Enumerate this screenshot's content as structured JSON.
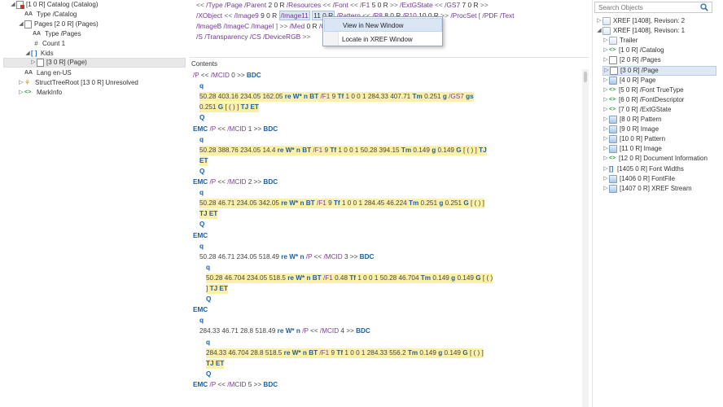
{
  "structure_tree": {
    "items": [
      {
        "label": "[1 0 R] Catalog  (Catalog)",
        "icon": "catalog-icon"
      },
      {
        "label": "Type /Catalog",
        "icon": "name-aa-icon"
      },
      {
        "label": "Pages [2 0 R]  (Pages)",
        "icon": "pages-icon"
      },
      {
        "label": "Type /Pages",
        "icon": "name-aa-icon"
      },
      {
        "label": "Count 1",
        "icon": "hash-icon"
      },
      {
        "label": "Kids",
        "icon": "array-icon"
      },
      {
        "label": "[3 0 R]  (Page)",
        "icon": "page-icon"
      },
      {
        "label": "Lang en-US",
        "icon": "name-aa-icon"
      },
      {
        "label": "StructTreeRoot [13 0 R] Unresolved",
        "icon": "structtree-icon"
      },
      {
        "label": "MarkInfo",
        "icon": "dict-icon"
      }
    ]
  },
  "dictionary": {
    "line1": [
      "<<",
      "/Type",
      "/Page",
      "/Parent",
      "2 0 R",
      "/Resources",
      "<<",
      "/Font",
      "<<",
      "/F1",
      "5 0 R",
      ">>",
      "/ExtGState",
      "<<",
      "/GS7",
      "7 0 R",
      ">>"
    ],
    "line2": [
      "/XObject",
      "<<",
      "/Image9",
      "9 0 R",
      "/Image11",
      "11 0 R",
      "/Pattern",
      "<<",
      "/P8",
      "8 0 R",
      "/P10",
      "10 0 R",
      ">>",
      "/ProcSet",
      "[",
      "/PDF",
      "/Text"
    ],
    "line3": [
      "/ImageB",
      "/ImageC",
      "/ImageI",
      "]",
      ">>",
      "/Med",
      "0 R",
      "/Group",
      "<<",
      "/Type",
      "/Group"
    ],
    "line4": [
      "/S",
      "/Transparency",
      "/CS",
      "/DeviceRGB",
      ">>"
    ]
  },
  "context_menu": {
    "items": [
      "View in New Window",
      "Locate in XREF Window"
    ]
  },
  "contents": {
    "label": "Contents",
    "lines": [
      "/P  <<  /MCID  0  >>  BDC",
      "q",
      "50.28  403.16  234.05  162.05  re  W*  n  BT  /F1  9  Tf  1  0  0  1  284.33  407.71  Tm  0.251  g  /GS7  gs",
      "0.251  G  [  ( )  ]  TJ  ET",
      "Q",
      "EMC  /P  <<  /MCID  1  >>  BDC",
      "q",
      "50.28  388.76  234.05  14.4  re  W*  n  BT  /F1  9  Tf  1  0  0  1  50.28  394.15  Tm  0.149  g  0.149  G  [  ( )  ]  TJ",
      "ET",
      "Q",
      "EMC  /P  <<  /MCID  2  >>  BDC",
      "q",
      "50.28  46.71  234.05  342.05  re  W*  n  BT  /F1  9  Tf  1  0  0  1  284.45  46.224  Tm  0.251  g  0.251  G  [  ( )  ]",
      "TJ  ET",
      "Q",
      "EMC",
      "q",
      "50.28  46.71  234.05  518.49  re  W*  n  /P  <<  /MCID  3  >>  BDC",
      "q",
      "50.28  46.704  234.05  518.5  re  W*  n  BT  /F1  0.48  Tf  1  0  0  1  50.28  46.704  Tm  0.149  g  0.149  G  [  ( )",
      "]  TJ  ET",
      "Q",
      "EMC",
      "q",
      "284.33  46.71  28.8  518.49  re  W*  n  /P  <<  /MCID  4  >>  BDC",
      "q",
      "284.33  46.704  28.8  518.5  re  W*  n  BT  /F1  9  Tf  1  0  0  1  284.33  556.2  Tm  0.149  g  0.149  G  [  ( )  ]",
      "TJ  ET",
      "Q",
      "EMC  /P  <<  /MCID  5  >>  BDC"
    ]
  },
  "objects_pane": {
    "search_placeholder": "Search Objects",
    "items": [
      {
        "label": "XREF [1408], Revison: 2",
        "kind": "xref"
      },
      {
        "label": "XREF [1408], Revison: 1",
        "kind": "xref"
      },
      {
        "label": "Trailer",
        "kind": "trailer"
      },
      {
        "label": "[1 0 R] /Catalog",
        "kind": "dict"
      },
      {
        "label": "[2 0 R] /Pages",
        "kind": "pages"
      },
      {
        "label": "[3 0 R] /Page",
        "kind": "page"
      },
      {
        "label": "[4 0 R] Page",
        "kind": "stream"
      },
      {
        "label": "[5 0 R] /Font TrueType",
        "kind": "dict"
      },
      {
        "label": "[6 0 R] /FontDescriptor",
        "kind": "dict"
      },
      {
        "label": "[7 0 R] /ExtGState",
        "kind": "dict"
      },
      {
        "label": "[8 0 R] Pattern",
        "kind": "stream"
      },
      {
        "label": "[9 0 R] Image",
        "kind": "stream"
      },
      {
        "label": "[10 0 R] Pattern",
        "kind": "stream"
      },
      {
        "label": "[11 0 R] Image",
        "kind": "stream"
      },
      {
        "label": "[12 0 R] Document Information",
        "kind": "dict"
      },
      {
        "label": "[1405 0 R] Font Widths",
        "kind": "array"
      },
      {
        "label": "[1406 0 R] FontFile",
        "kind": "stream"
      },
      {
        "label": "[1407 0 R] XREF Stream",
        "kind": "stream"
      }
    ]
  }
}
